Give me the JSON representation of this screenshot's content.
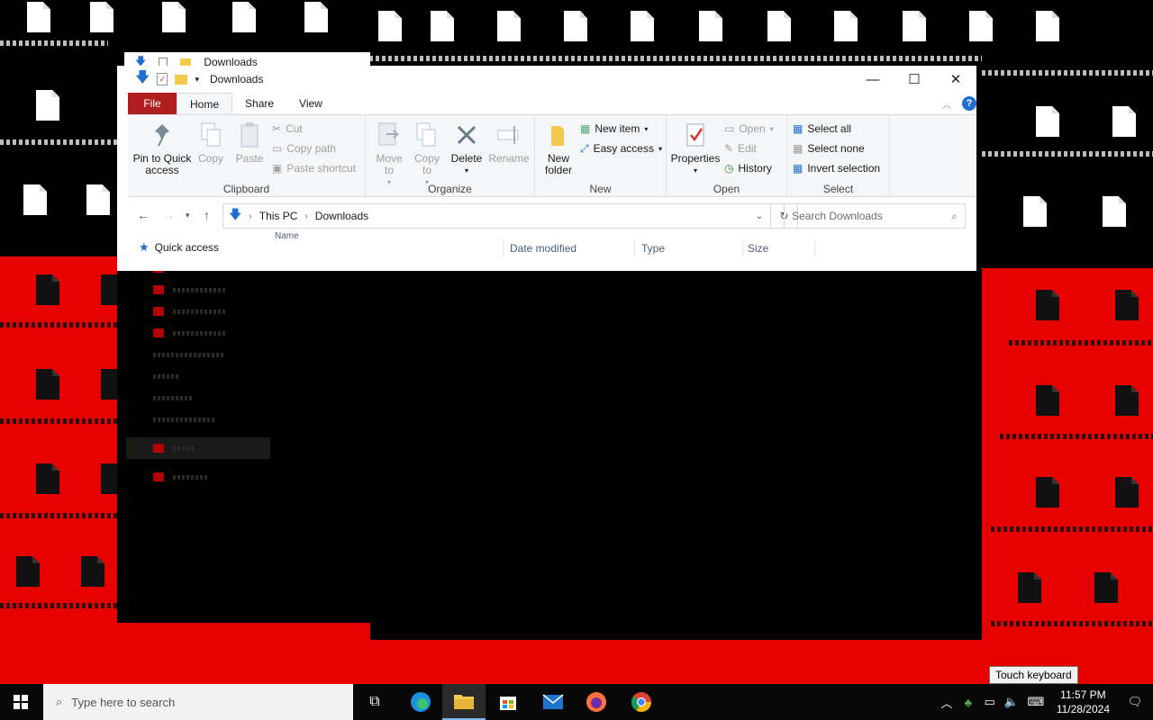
{
  "window": {
    "title": "Downloads",
    "ghost_title": "Downloads",
    "controls": {
      "minimize": "—",
      "maximize": "☐",
      "close": "✕"
    }
  },
  "tabs": {
    "file": "File",
    "home": "Home",
    "share": "Share",
    "view": "View"
  },
  "ribbon": {
    "clipboard": {
      "label": "Clipboard",
      "pin": "Pin to Quick access",
      "copy": "Copy",
      "paste": "Paste",
      "cut": "Cut",
      "copy_path": "Copy path",
      "paste_shortcut": "Paste shortcut"
    },
    "organize": {
      "label": "Organize",
      "move_to": "Move to",
      "copy_to": "Copy to",
      "delete": "Delete",
      "rename": "Rename"
    },
    "new": {
      "label": "New",
      "new_folder": "New folder",
      "new_item": "New item",
      "easy_access": "Easy access"
    },
    "open": {
      "label": "Open",
      "properties": "Properties",
      "open": "Open",
      "edit": "Edit",
      "history": "History"
    },
    "select": {
      "label": "Select",
      "select_all": "Select all",
      "select_none": "Select none",
      "invert": "Invert selection"
    }
  },
  "address": {
    "crumbs": [
      "This PC",
      "Downloads"
    ],
    "search_placeholder": "Search Downloads"
  },
  "navpane": {
    "quick_access": "Quick access"
  },
  "columns": {
    "name": "Name",
    "date_modified": "Date modified",
    "type": "Type",
    "size": "Size"
  },
  "taskbar": {
    "search_placeholder": "Type here to search",
    "time": "11:57 PM",
    "date": "11/28/2024",
    "tooltip": "Touch keyboard"
  },
  "colors": {
    "file_tab": "#b01e1e",
    "accent": "#1e6fcf",
    "desktop_red": "#e60000"
  }
}
